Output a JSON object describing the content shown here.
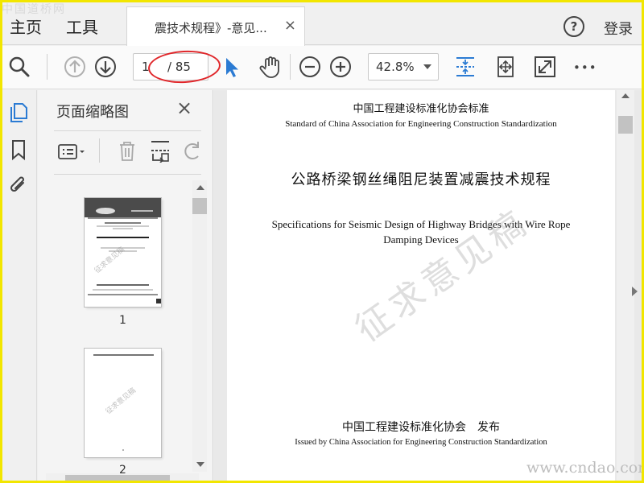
{
  "watermark_logo": "中国道桥网",
  "nav": {
    "home_label": "主页",
    "tools_label": "工具",
    "login_label": "登录",
    "help_glyph": "?"
  },
  "tab": {
    "title": "震技术规程》-意见...",
    "close_glyph": "×"
  },
  "toolbar": {
    "page_current": "1",
    "page_total": "/ 85",
    "zoom_value": "42.8%",
    "more_glyph": "•••",
    "icons": [
      "search-icon",
      "previous-page-icon",
      "next-page-icon",
      "select-cursor-icon",
      "hand-tool-icon",
      "zoom-out-icon",
      "zoom-in-icon",
      "fit-page-icon",
      "rotate-fit-icon",
      "full-screen-icon",
      "more-icon"
    ]
  },
  "accent_color": "#2b7bd3",
  "annotation_color": "#e0262a",
  "left_rail": {
    "icons": [
      "page-thumbnails-icon",
      "bookmarks-icon",
      "attachments-icon"
    ]
  },
  "panel": {
    "title": "页面缩略图",
    "close_glyph": "×",
    "thumbnails": [
      {
        "label": "1",
        "stamp": "征求意见稿"
      },
      {
        "label": "2",
        "stamp": "征求意见稿"
      }
    ]
  },
  "document": {
    "header_cn": "中国工程建设标准化协会标准",
    "header_en": "Standard of China Association for Engineering Construction Standardization",
    "title_cn": "公路桥梁钢丝绳阻尼装置减震技术规程",
    "title_en": "Specifications for Seismic Design of Highway Bridges with Wire Rope Damping Devices",
    "stamp": "征求意见稿",
    "publisher_cn": "中国工程建设标准化协会　发布",
    "publisher_en": "Issued by China Association for Engineering Construction Standardization"
  },
  "site_mark": "www.cndao.com"
}
